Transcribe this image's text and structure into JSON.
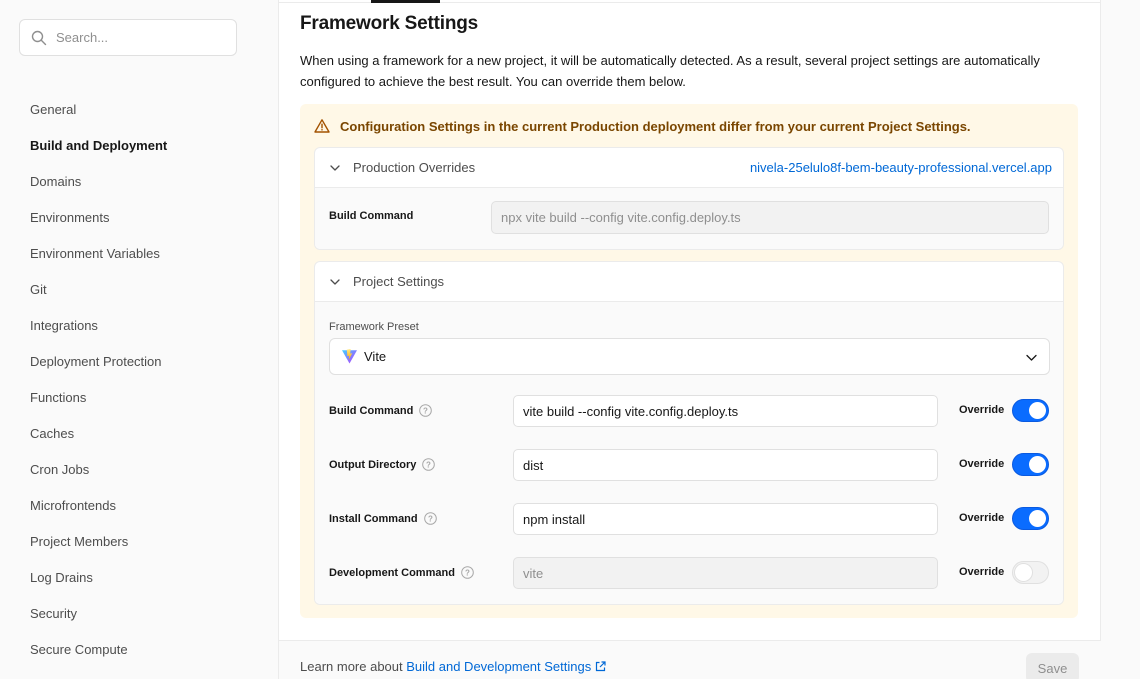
{
  "sidebar": {
    "search_placeholder": "Search...",
    "items": [
      {
        "label": "General"
      },
      {
        "label": "Build and Deployment"
      },
      {
        "label": "Domains"
      },
      {
        "label": "Environments"
      },
      {
        "label": "Environment Variables"
      },
      {
        "label": "Git"
      },
      {
        "label": "Integrations"
      },
      {
        "label": "Deployment Protection"
      },
      {
        "label": "Functions"
      },
      {
        "label": "Caches"
      },
      {
        "label": "Cron Jobs"
      },
      {
        "label": "Microfrontends"
      },
      {
        "label": "Project Members"
      },
      {
        "label": "Log Drains"
      },
      {
        "label": "Security"
      },
      {
        "label": "Secure Compute"
      }
    ],
    "active_item": "Build and Deployment"
  },
  "main": {
    "title": "Framework Settings",
    "description": "When using a framework for a new project, it will be automatically detected. As a result, several project settings are automatically configured to achieve the best result. You can override them below.",
    "warning": "Configuration Settings in the current Production deployment differ from your current Project Settings.",
    "production_overrides": {
      "label": "Production Overrides",
      "deployment_link": "nivela-25elulo8f-bem-beauty-professional.vercel.app",
      "build_command_label": "Build Command",
      "build_command_value": "npx vite build --config vite.config.deploy.ts"
    },
    "project_settings": {
      "label": "Project Settings",
      "framework_preset_label": "Framework Preset",
      "framework_preset_value": "Vite",
      "override_label": "Override",
      "fields": [
        {
          "label": "Build Command",
          "value": "vite build --config vite.config.deploy.ts",
          "override": true
        },
        {
          "label": "Output Directory",
          "value": "dist",
          "override": true
        },
        {
          "label": "Install Command",
          "value": "npm install",
          "override": true
        },
        {
          "label": "Development Command",
          "value": "vite",
          "override": false
        }
      ]
    }
  },
  "footer": {
    "learn_more_prefix": "Learn more about ",
    "learn_more_link": "Build and Development Settings",
    "save_label": "Save"
  },
  "colors": {
    "accent": "#0a6cff",
    "link": "#0068d6",
    "warning_bg": "#fff8e7",
    "warning_text": "#7a4600"
  },
  "icons": [
    "search-icon",
    "warning-icon",
    "chevron-down-icon",
    "help-icon",
    "vite-logo-icon",
    "external-link-icon"
  ]
}
